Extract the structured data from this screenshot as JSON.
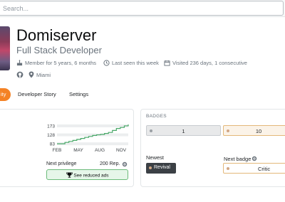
{
  "search": {
    "placeholder": "Search..."
  },
  "profile": {
    "name": "Domiserver",
    "role": "Full Stack Developer",
    "member_for": "Member for 5 years, 6 months",
    "last_seen": "Last seen this week",
    "visited": "Visited 236 days, 1 consecutive",
    "location": "Miami"
  },
  "tabs": [
    {
      "label": "ity",
      "active": true
    },
    {
      "label": "Developer Story",
      "active": false
    },
    {
      "label": "Settings",
      "active": false
    }
  ],
  "reputation": {
    "chart_data": {
      "type": "line",
      "x_ticks": [
        "FEB",
        "MAY",
        "AUG",
        "NOV"
      ],
      "y_ticks": [
        83,
        128,
        173
      ],
      "series": [
        {
          "values": [
            83,
            83,
            90,
            95,
            100,
            105,
            110,
            115,
            120,
            125,
            128,
            130,
            135,
            140,
            150,
            160,
            165,
            173,
            180
          ]
        }
      ],
      "accent": "#48a868"
    },
    "next_privilege_label": "Next privilege",
    "next_privilege_value": "200 Rep.",
    "reduced_ads_label": "See reduced ads"
  },
  "badges": {
    "title": "BADGES",
    "silver_count": "1",
    "bronze_count": "10",
    "newest_label": "Newest",
    "newest_badge": "Revival",
    "next_badge_label": "Next badge",
    "next_badge": "Critic"
  },
  "colors": {
    "accent": "#f48225",
    "chart_line": "#48a868"
  }
}
